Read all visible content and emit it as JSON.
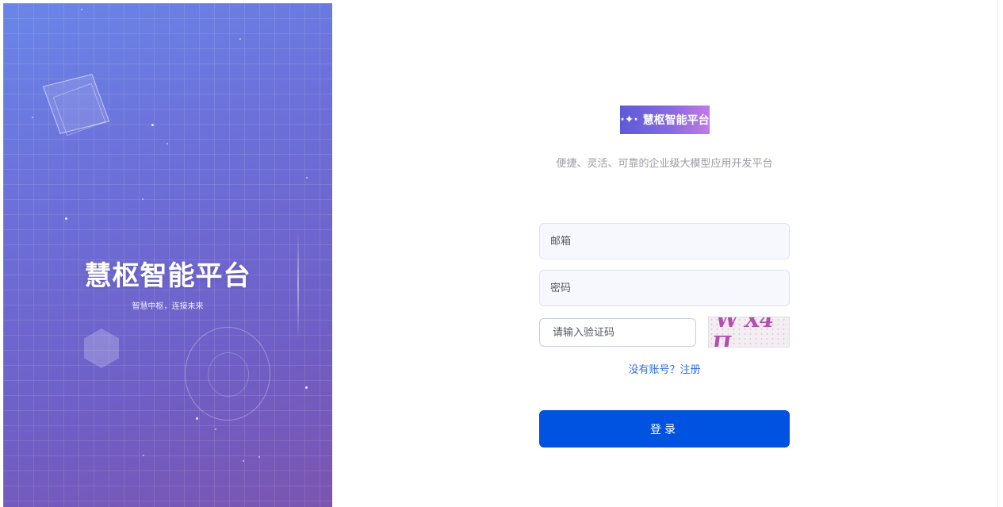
{
  "hero": {
    "title": "慧枢智能平台",
    "subtitle": "智慧中枢，连接未来"
  },
  "brand": {
    "logo_text": "慧枢智能平台",
    "logo_icon": "sparkle-icon",
    "tagline": "便捷、灵活、可靠的企业级大模型应用开发平台"
  },
  "form": {
    "email_placeholder": "邮箱",
    "password_placeholder": "密码",
    "captcha_placeholder": "请输入验证码",
    "captcha_text": "W X4 П",
    "register_link": "没有账号？注册",
    "login_button": "登录"
  },
  "colors": {
    "primary": "#0052e0",
    "link": "#2f6fe0",
    "hero_gradient_start": "#6a86e8",
    "hero_gradient_end": "#7a55b0"
  }
}
